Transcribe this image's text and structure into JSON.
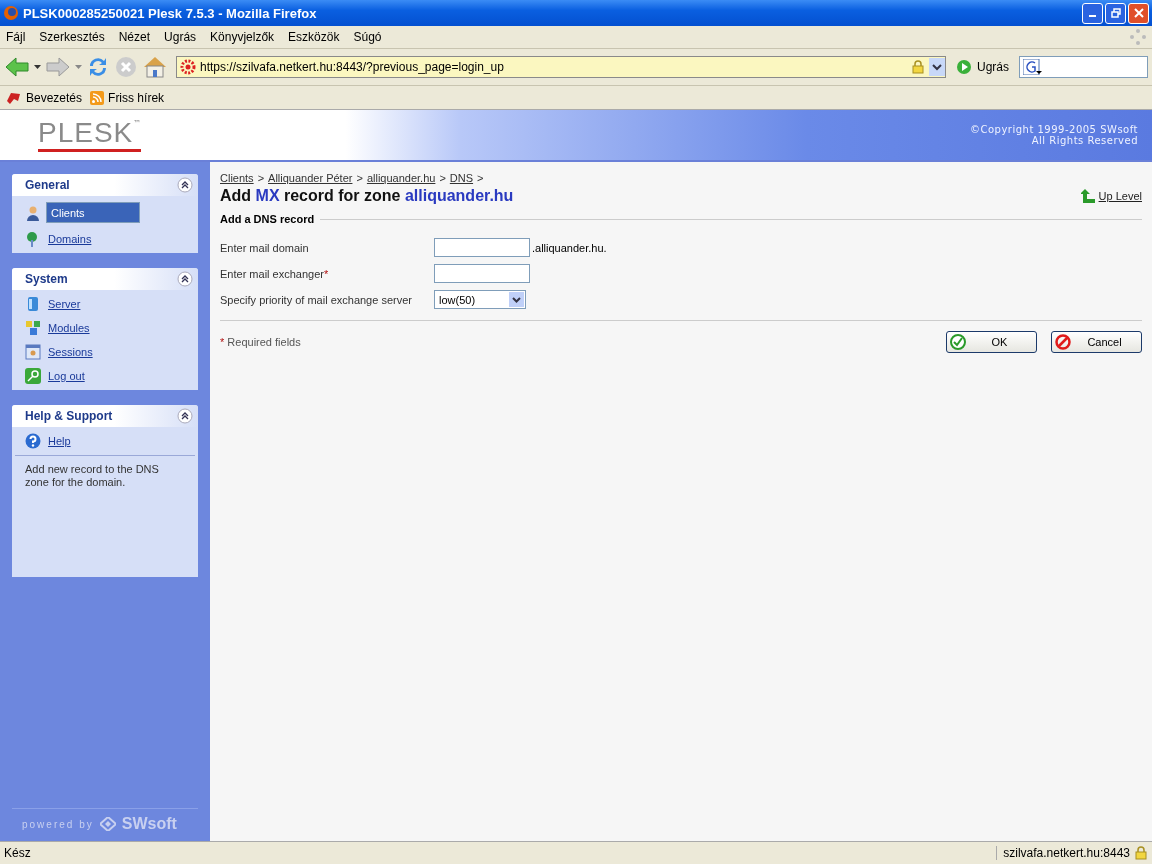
{
  "window": {
    "title": "PLSK000285250021 Plesk 7.5.3 - Mozilla Firefox"
  },
  "menu": [
    "Fájl",
    "Szerkesztés",
    "Nézet",
    "Ugrás",
    "Könyvjelzők",
    "Eszközök",
    "Súgó"
  ],
  "address": {
    "url": "https://szilvafa.netkert.hu:8443/?previous_page=login_up",
    "go_label": "Ugrás"
  },
  "bookmarks": [
    "Bevezetés",
    "Friss hírek"
  ],
  "header": {
    "logo": "PLESK",
    "trademark": "™",
    "copyright": [
      "©Copyright 1999-2005 SWsoft",
      "All Rights Reserved"
    ]
  },
  "sidebar": {
    "sections": [
      {
        "title": "General",
        "items": [
          {
            "label": "Clients",
            "selected": true
          },
          {
            "label": "Domains",
            "selected": false
          }
        ]
      },
      {
        "title": "System",
        "items": [
          {
            "label": "Server",
            "selected": false
          },
          {
            "label": "Modules",
            "selected": false
          },
          {
            "label": "Sessions",
            "selected": false
          },
          {
            "label": "Log out",
            "selected": false
          }
        ]
      },
      {
        "title": "Help & Support",
        "items": [
          {
            "label": "Help",
            "selected": false
          }
        ],
        "note": "Add new record to the DNS zone for the domain."
      }
    ],
    "powered_by": "powered by",
    "brand": "SWsoft"
  },
  "breadcrumbs": [
    "Clients",
    "Alliquander Péter",
    "alliquander.hu",
    "DNS"
  ],
  "breadcrumb_separator": ">",
  "heading": [
    {
      "text": "Add ",
      "highlight": false
    },
    {
      "text": "MX",
      "highlight": true
    },
    {
      "text": " record for zone ",
      "highlight": false
    },
    {
      "text": "alliquander.hu",
      "highlight": true
    }
  ],
  "up_level": "Up Level",
  "form": {
    "title": "Add a DNS record",
    "required_mark": "*",
    "fields": [
      {
        "kind": "text",
        "label": "Enter mail domain",
        "required": false,
        "suffix": ".alliquander.hu."
      },
      {
        "kind": "text",
        "label": "Enter mail exchanger",
        "required": true
      },
      {
        "kind": "select",
        "label": "Specify priority of mail exchange server",
        "required": false,
        "value": "low(50)"
      }
    ],
    "required_note": "Required fields"
  },
  "buttons": [
    {
      "kind": "ok",
      "label": "OK"
    },
    {
      "kind": "cancel",
      "label": "Cancel"
    }
  ],
  "status_bar": {
    "text": "Kész",
    "host": "szilvafa.netkert.hu:8443"
  }
}
